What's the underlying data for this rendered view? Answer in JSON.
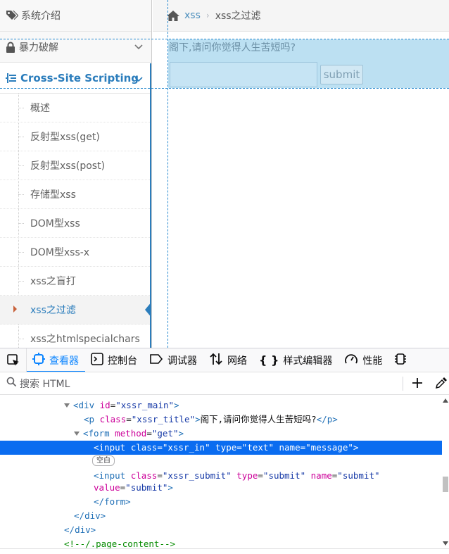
{
  "sidebar": {
    "top_item": "系统介绍",
    "group_bruteforce": "暴力破解",
    "group_xss": "Cross-Site Scripting",
    "sub_items": [
      "概述",
      "反射型xss(get)",
      "反射型xss(post)",
      "存储型xss",
      "DOM型xss",
      "DOM型xss-x",
      "xss之盲打",
      "xss之过滤",
      "xss之htmlspecialchars"
    ],
    "current_index": 7
  },
  "breadcrumb": {
    "link": "xss",
    "separator": "›",
    "current": "xss之过滤"
  },
  "main": {
    "title": "阁下,请问你觉得人生苦短吗?",
    "input_value": "",
    "submit_label": "submit"
  },
  "devtools": {
    "tabs": [
      {
        "label": "查看器",
        "icon": "inspector-icon"
      },
      {
        "label": "控制台",
        "icon": "console-icon"
      },
      {
        "label": "调试器",
        "icon": "debugger-icon"
      },
      {
        "label": "网络",
        "icon": "network-icon"
      },
      {
        "label": "样式编辑器",
        "icon": "style-editor-icon"
      },
      {
        "label": "性能",
        "icon": "performance-icon"
      }
    ],
    "search_placeholder": "搜索 HTML",
    "badge": "空白",
    "tree": {
      "div_main": {
        "tag": "div",
        "attr": "id",
        "val": "xssr_main"
      },
      "p_title": {
        "tag": "p",
        "attr": "class",
        "val": "xssr_title",
        "text": "阁下,请问你觉得人生苦短吗?"
      },
      "form": {
        "tag": "form",
        "attr": "method",
        "val": "get"
      },
      "input_in": {
        "tag": "input",
        "attr1": "class",
        "val1": "xssr_in",
        "attr2": "type",
        "val2": "text",
        "attr3": "name",
        "val3": "message"
      },
      "input_submit": {
        "tag": "input",
        "attr1": "class",
        "val1": "xssr_submit",
        "attr2": "type",
        "val2": "submit",
        "attr3": "name",
        "val3": "submit",
        "attr4": "value",
        "val4": "submit"
      },
      "close_form": "form",
      "close_div1": "div",
      "close_div2": "div",
      "comment": "<!--/.page-content-->"
    }
  }
}
